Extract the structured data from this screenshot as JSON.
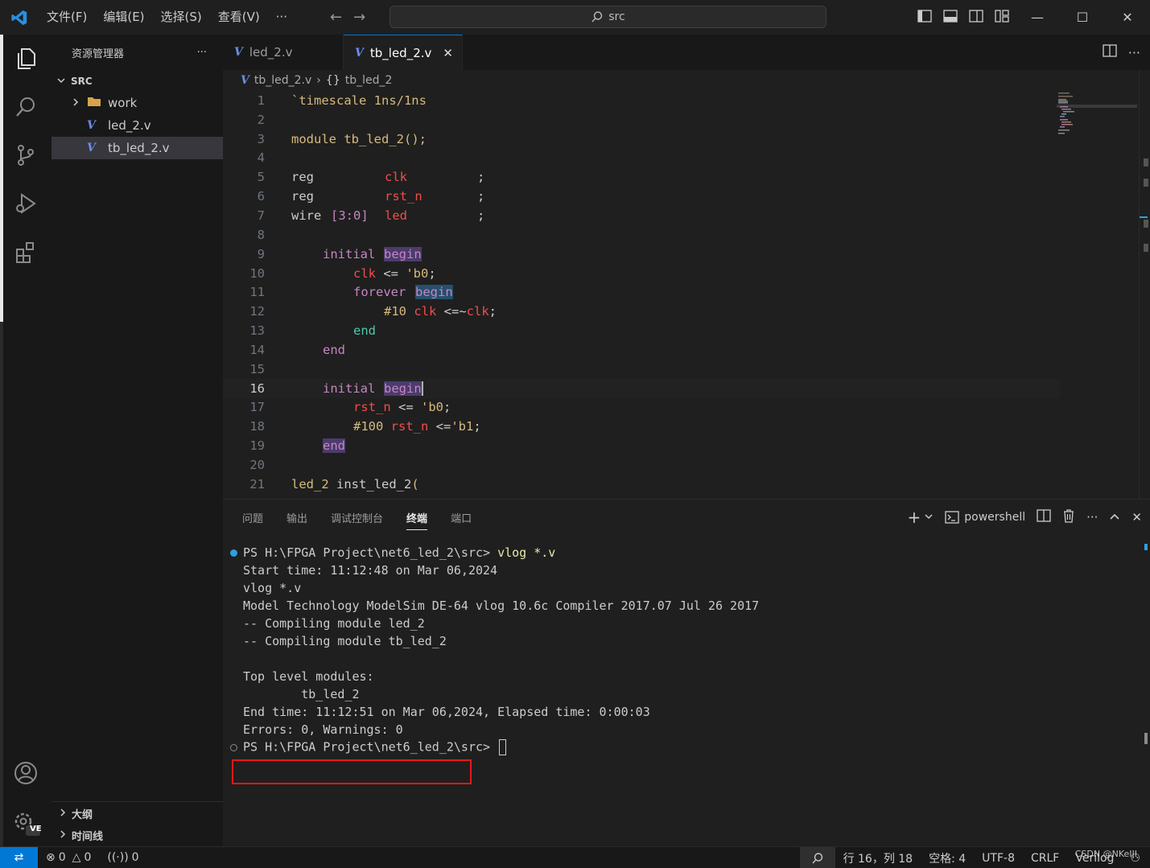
{
  "titlebar": {
    "menu": [
      "文件(F)",
      "编辑(E)",
      "选择(S)",
      "查看(V)",
      "···"
    ],
    "search_text": "src"
  },
  "sidebar": {
    "header": "资源管理器",
    "more": "···",
    "root": "SRC",
    "items": [
      {
        "label": "work",
        "type": "folder"
      },
      {
        "label": "led_2.v",
        "type": "verilog"
      },
      {
        "label": "tb_led_2.v",
        "type": "verilog",
        "selected": true
      }
    ],
    "sections": [
      "大纲",
      "时间线"
    ],
    "account_badge": "VE"
  },
  "tabs": [
    {
      "label": "led_2.v",
      "active": false
    },
    {
      "label": "tb_led_2.v",
      "active": true
    }
  ],
  "breadcrumb": {
    "file": "tb_led_2.v",
    "symbol": "tb_led_2"
  },
  "editor": {
    "current_line": 16,
    "lines": [
      {
        "n": "1"
      },
      {
        "n": "2"
      },
      {
        "n": "3"
      },
      {
        "n": "4"
      },
      {
        "n": "5"
      },
      {
        "n": "6"
      },
      {
        "n": "7"
      },
      {
        "n": "8"
      },
      {
        "n": "9"
      },
      {
        "n": "10"
      },
      {
        "n": "11"
      },
      {
        "n": "12"
      },
      {
        "n": "13"
      },
      {
        "n": "14"
      },
      {
        "n": "15"
      },
      {
        "n": "16"
      },
      {
        "n": "17"
      },
      {
        "n": "18"
      },
      {
        "n": "19"
      },
      {
        "n": "20"
      },
      {
        "n": "21"
      }
    ],
    "code": {
      "l1": "`timescale 1ns/1ns",
      "l3_kw": "module",
      "l3_name": " tb_led_2",
      "l3_rest": "();",
      "l5_kw": "reg",
      "l5_sig": "clk",
      "l6_kw": "reg",
      "l6_sig": "rst_n",
      "l7_kw": "wire",
      "l7_range": "[3:0]",
      "l7_sig": "led",
      "semi": ";",
      "initial": "initial",
      "begin": "begin",
      "end": "end",
      "forever": "forever",
      "l10_sig": "clk",
      "l10_op": " <= ",
      "l10_val": "'b0",
      "l12_delay": "#10",
      "l12_sig": " clk",
      "l12_op": " <=~",
      "l12_sig2": "clk",
      "l17_sig": "rst_n",
      "l17_op": " <= ",
      "l17_val": "'b0",
      "l18_delay": "#100",
      "l18_sig": " rst_n",
      "l18_op": " <=",
      "l18_val": "'b1",
      "l21_mod": "led_2",
      "l21_inst": " inst_led_2",
      "l21_paren": "("
    }
  },
  "panel": {
    "tabs": [
      "问题",
      "输出",
      "调试控制台",
      "终端",
      "端口"
    ],
    "active_tab": "终端",
    "shell": "powershell",
    "terminal": [
      {
        "prompt": "PS H:\\FPGA Project\\net6_led_2\\src> ",
        "cmd": "vlog *.v",
        "marker": "blue"
      },
      {
        "text": "Start time: 11:12:48 on Mar 06,2024"
      },
      {
        "text": "vlog *.v"
      },
      {
        "text": "Model Technology ModelSim DE-64 vlog 10.6c Compiler 2017.07 Jul 26 2017"
      },
      {
        "text": "-- Compiling module led_2"
      },
      {
        "text": "-- Compiling module tb_led_2"
      },
      {
        "text": ""
      },
      {
        "text": "Top level modules:"
      },
      {
        "text": "        tb_led_2"
      },
      {
        "text": "End time: 11:12:51 on Mar 06,2024, Elapsed time: 0:00:03"
      },
      {
        "text": "Errors: 0, Warnings: 0"
      },
      {
        "prompt": "PS H:\\FPGA Project\\net6_led_2\\src> ",
        "cmd": "",
        "marker": "hollow"
      }
    ]
  },
  "statusbar": {
    "errors": "0",
    "warnings": "0",
    "ports": "0",
    "position": "行 16，列 18",
    "spaces": "空格: 4",
    "encoding": "UTF-8",
    "eol": "CRLF",
    "language": "Verilog",
    "watermark": "CSDN @NKeIII"
  },
  "colors": {
    "accent": "#0078d4",
    "highlight_box": "#e81818"
  }
}
